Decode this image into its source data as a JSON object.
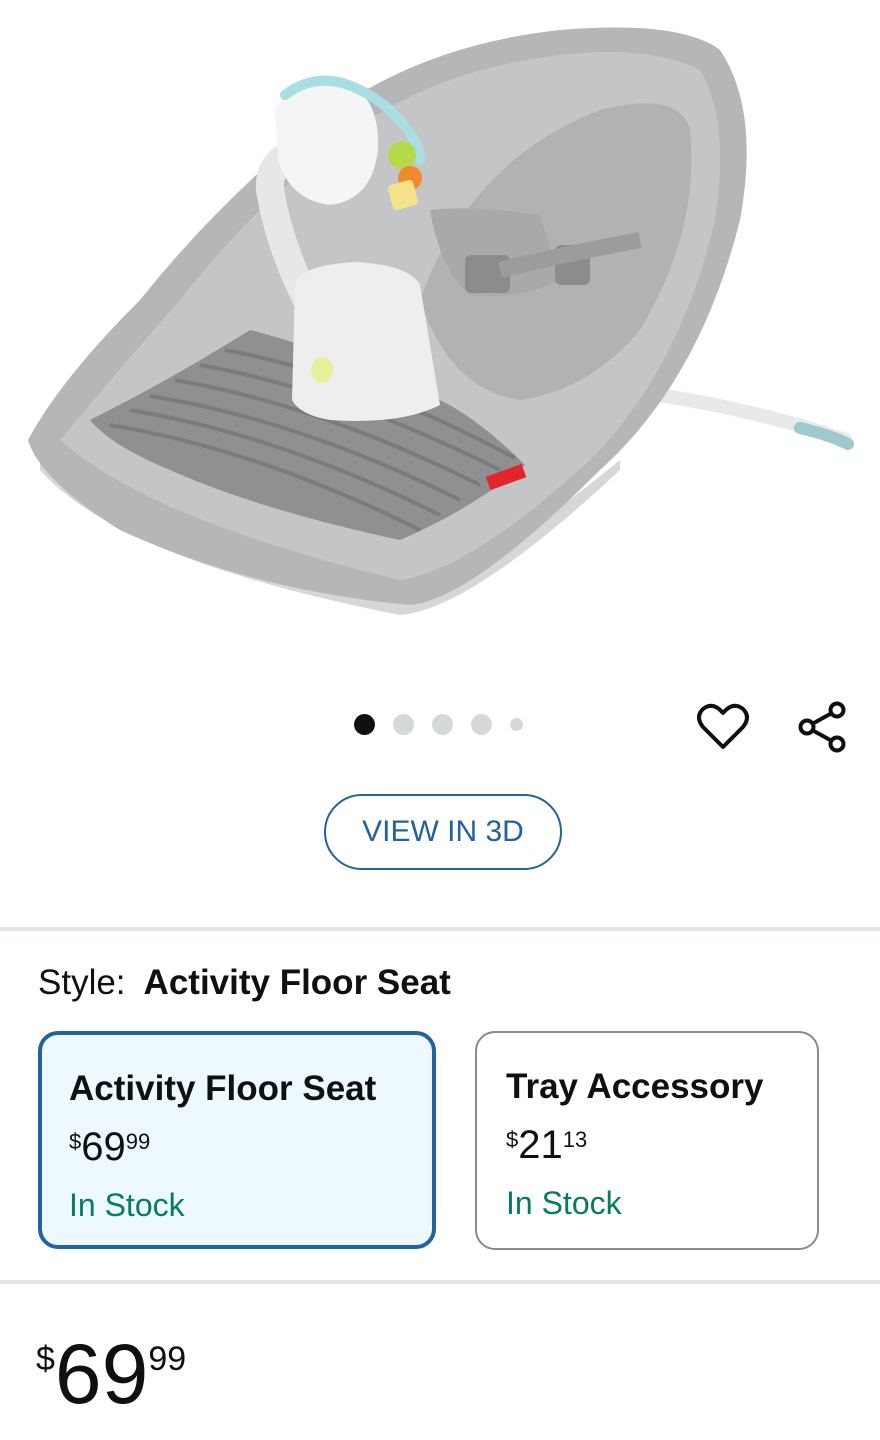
{
  "product_image": {
    "alt": "Activity floor seat product photo"
  },
  "gallery": {
    "dot_count": 5,
    "active_index": 0
  },
  "actions": {
    "favorite_icon": "heart-icon",
    "share_icon": "share-icon"
  },
  "view_3d_label": "VIEW IN 3D",
  "style": {
    "label": "Style:",
    "selected_value": "Activity Floor Seat"
  },
  "options": [
    {
      "name": "Activity Floor Seat",
      "price_symbol": "$",
      "price_whole": "69",
      "price_cents": "99",
      "stock": "In Stock",
      "selected": true
    },
    {
      "name": "Tray Accessory",
      "price_symbol": "$",
      "price_whole": "21",
      "price_cents": "13",
      "stock": "In Stock",
      "selected": false
    }
  ],
  "price": {
    "symbol": "$",
    "whole": "69",
    "cents": "99"
  },
  "colors": {
    "accent_blue": "#2162a1",
    "stock_green": "#067d62",
    "selected_bg": "#edf8ff"
  }
}
